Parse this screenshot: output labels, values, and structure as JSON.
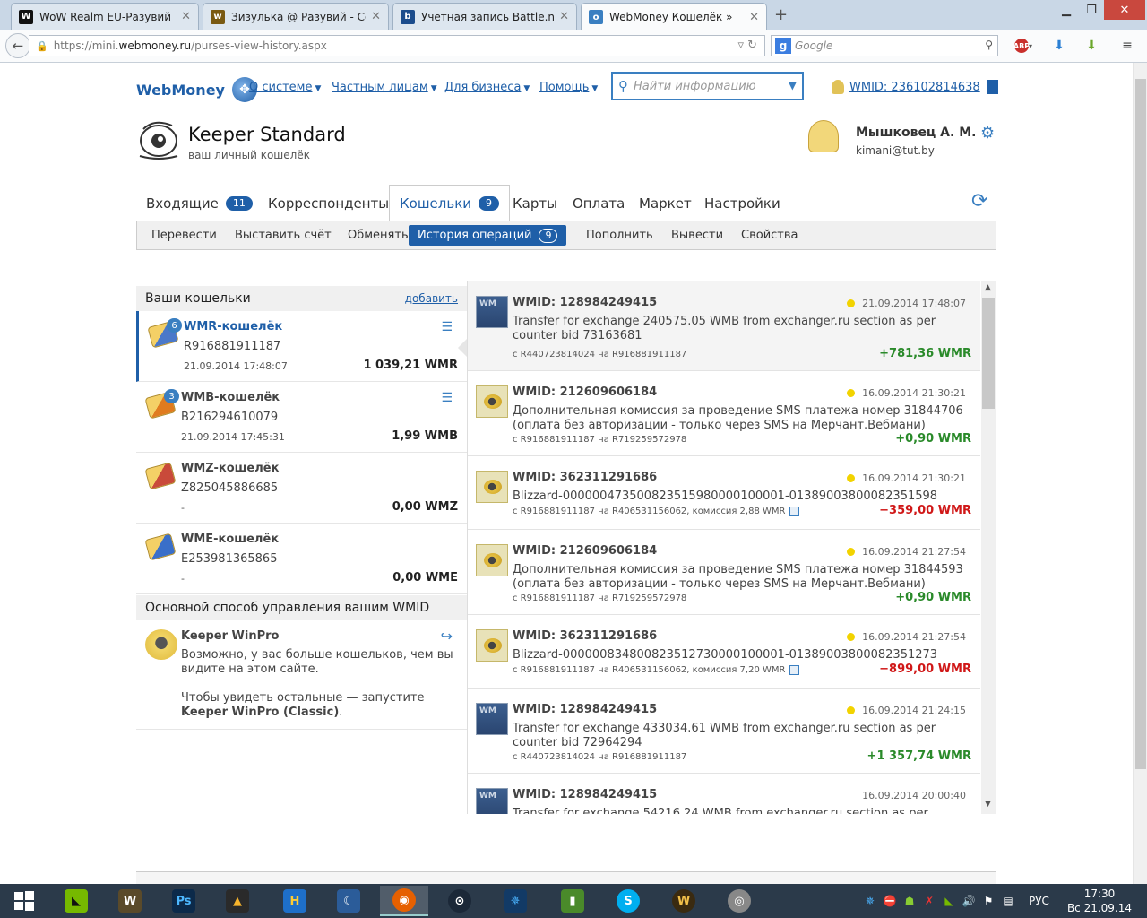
{
  "browser": {
    "tabs": [
      {
        "title": "WoW Realm EU-Разувий :: …",
        "fav": "W",
        "fav_color": "#111111"
      },
      {
        "title": "Зизулька @ Разувий - Co…",
        "fav": "w",
        "fav_color": "#7a5a12"
      },
      {
        "title": "Учетная запись Battle.net",
        "fav": "b",
        "fav_color": "#1b4c8c"
      },
      {
        "title": "WebMoney Кошелёк »",
        "fav": "o",
        "fav_color": "#3a7fc1",
        "active": true
      }
    ],
    "new_tab": "+",
    "url_prefix": "https://mini.",
    "url_host": "webmoney.ru",
    "url_path": "/purses-view-history.aspx",
    "search_placeholder": "Google",
    "search_engine": "g"
  },
  "site": {
    "logo_text": "WebMoney",
    "nav": [
      "О системе",
      "Частным лицам",
      "Для бизнеса",
      "Помощь"
    ],
    "search_placeholder": "Найти информацию",
    "wmid_link": "WMID: 236102814638"
  },
  "keeper": {
    "title": "Keeper Standard",
    "subtitle": "ваш личный кошелёк"
  },
  "user": {
    "name": "Мышковец А. М.",
    "email": "kimani@tut.by"
  },
  "main_tabs": [
    {
      "label": "Входящие",
      "badge": "11"
    },
    {
      "label": "Корреспонденты"
    },
    {
      "label": "Кошельки",
      "badge": "9",
      "active": true
    },
    {
      "label": "Карты"
    },
    {
      "label": "Оплата"
    },
    {
      "label": "Маркет"
    },
    {
      "label": "Настройки"
    }
  ],
  "sub_tabs": [
    {
      "label": "Перевести"
    },
    {
      "label": "Выставить счёт"
    },
    {
      "label": "Обменять"
    },
    {
      "label": "История операций",
      "badge": "9",
      "active": true
    },
    {
      "label": "Пополнить"
    },
    {
      "label": "Вывести"
    },
    {
      "label": "Свойства"
    }
  ],
  "purses_header": "Ваши кошельки",
  "purses_add": "добавить",
  "purses": [
    {
      "name": "WMR-кошелёк",
      "number": "R916881911187",
      "date": "21.09.2014 17:48:07",
      "balance": "1 039,21 WMR",
      "count": "6",
      "color": "#4a78c9",
      "selected": true,
      "list_icon": true
    },
    {
      "name": "WMB-кошелёк",
      "number": "B216294610079",
      "date": "21.09.2014 17:45:31",
      "balance": "1,99 WMB",
      "count": "3",
      "color": "#e07b1f",
      "list_icon": true
    },
    {
      "name": "WMZ-кошелёк",
      "number": "Z825045886685",
      "date": "-",
      "balance": "0,00 WMZ",
      "color": "#c94a3a"
    },
    {
      "name": "WME-кошелёк",
      "number": "E253981365865",
      "date": "-",
      "balance": "0,00 WME",
      "color": "#3a6fc9"
    }
  ],
  "mgmt": {
    "header": "Основной способ управления вашим WMID",
    "title": "Keeper WinPro",
    "text1": "Возможно, у вас больше кошельков, чем вы видите на этом сайте.",
    "text2_prefix": "Чтобы увидеть остальные — запустите ",
    "text2_bold": "Keeper WinPro (Classic)",
    "text2_suffix": "."
  },
  "transactions": [
    {
      "wmid": "WMID: 128984249415",
      "date": "21.09.2014 17:48:07",
      "dot": true,
      "desc": "Transfer for exchange 240575.05 WMB from exchanger.ru section as per counter bid 73163681",
      "route": "с R440723814024 на R916881911187",
      "receipt": false,
      "amount": "+781,36 WMR",
      "sign": "pos",
      "icon": "exch"
    },
    {
      "wmid": "WMID: 212609606184",
      "date": "16.09.2014 21:30:21",
      "dot": true,
      "desc": "Дополнительная комиссия за проведение SMS платежа номер 31844706 (оплата без авторизации - только через SMS на Мерчант.Вебмани)",
      "route": "с R916881911187 на R719259572978",
      "receipt": false,
      "amount": "+0,90 WMR",
      "sign": "pos",
      "icon": "sms"
    },
    {
      "wmid": "WMID: 362311291686",
      "date": "16.09.2014 21:30:21",
      "dot": true,
      "desc": "Blizzard-0000004735008235159800001000​01-01389003800082351598",
      "route": "с R916881911187 на R406531156062, комиссия 2,88 WMR",
      "receipt": true,
      "amount": "−359,00 WMR",
      "sign": "neg",
      "icon": "sms"
    },
    {
      "wmid": "WMID: 212609606184",
      "date": "16.09.2014 21:27:54",
      "dot": true,
      "desc": "Дополнительная комиссия за проведение SMS платежа номер 31844593 (оплата без авторизации - только через SMS на Мерчант.Вебмани)",
      "route": "с R916881911187 на R719259572978",
      "receipt": false,
      "amount": "+0,90 WMR",
      "sign": "pos",
      "icon": "sms"
    },
    {
      "wmid": "WMID: 362311291686",
      "date": "16.09.2014 21:27:54",
      "dot": true,
      "desc": "Blizzard-0000008348008235127300001000​01-01389003800082351273",
      "route": "с R916881911187 на R406531156062, комиссия 7,20 WMR",
      "receipt": true,
      "amount": "−899,00 WMR",
      "sign": "neg",
      "icon": "sms"
    },
    {
      "wmid": "WMID: 128984249415",
      "date": "16.09.2014 21:24:15",
      "dot": true,
      "desc": "Transfer for exchange 433034.61 WMB from exchanger.ru section as per counter bid 72964294",
      "route": "с R440723814024 на R916881911187",
      "receipt": false,
      "amount": "+1 357,74 WMR",
      "sign": "pos",
      "icon": "exch"
    },
    {
      "wmid": "WMID: 128984249415",
      "date": "16.09.2014 20:00:40",
      "dot": false,
      "desc": "Transfer for exchange 54216.24 WMB from exchanger.ru section as per",
      "route": "",
      "receipt": false,
      "amount": "",
      "sign": "pos",
      "icon": "exch"
    }
  ],
  "taskbar": {
    "lang": "РУС",
    "time": "17:30",
    "date": "Вс 21.09.14"
  }
}
